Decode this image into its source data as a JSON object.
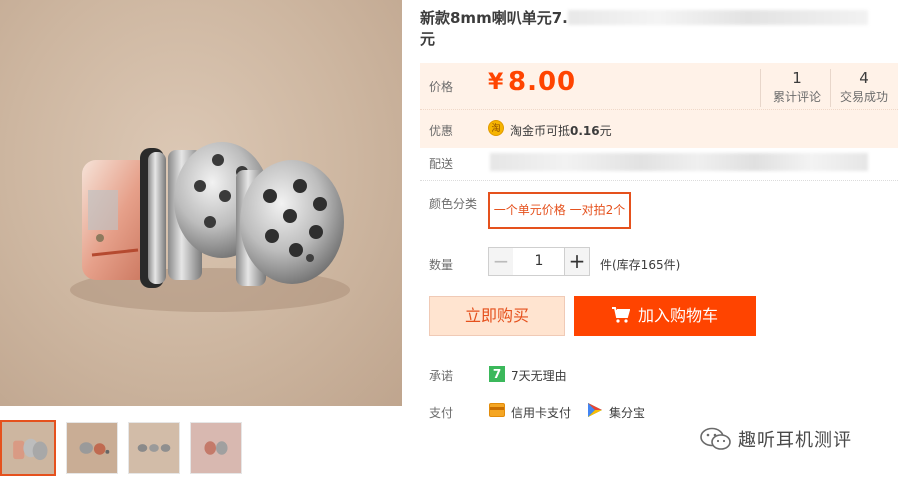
{
  "gallery": {
    "main_image": "earphone-driver-photo",
    "thumbnails": [
      {
        "name": "thumbnail-1",
        "active": true
      },
      {
        "name": "thumbnail-2",
        "active": false
      },
      {
        "name": "thumbnail-3",
        "active": false
      },
      {
        "name": "thumbnail-4",
        "active": false
      }
    ]
  },
  "product": {
    "title_visible_start": "新款8mm喇叭单元7.",
    "title_visible_end": "元"
  },
  "price": {
    "label": "价格",
    "currency": "¥",
    "amount": "8.00",
    "stats": [
      {
        "value": "1",
        "label": "累计评论"
      },
      {
        "value": "4",
        "label": "交易成功"
      }
    ]
  },
  "promotion": {
    "label": "优惠",
    "icon": "taojinbi-coin-icon",
    "icon_glyph": "淘",
    "text_prefix": "淘金币可抵",
    "amount": "0.16",
    "unit": "元"
  },
  "shipping": {
    "label": "配送"
  },
  "sku": {
    "label": "颜色分类",
    "selected_option": "一个单元价格 一对拍2个"
  },
  "quantity": {
    "label": "数量",
    "minus": "−",
    "value": "1",
    "plus": "+",
    "stock_text": "件(库存165件)"
  },
  "actions": {
    "buy_now": "立即购买",
    "add_to_cart": "加入购物车"
  },
  "promise": {
    "label": "承诺",
    "icon_glyph": "7",
    "text": "7天无理由"
  },
  "payment": {
    "label": "支付",
    "methods": [
      {
        "icon": "credit-card-icon",
        "text": "信用卡支付"
      },
      {
        "icon": "jifenbao-icon",
        "text": "集分宝"
      }
    ]
  },
  "watermark": {
    "text": "趣听耳机测评"
  },
  "colors": {
    "accent": "#ff4400",
    "accent_border": "#e5511d",
    "price_panel_bg": "#fff2e8",
    "buy_now_bg": "#ffe4d0",
    "promise_green": "#3bb85b"
  }
}
